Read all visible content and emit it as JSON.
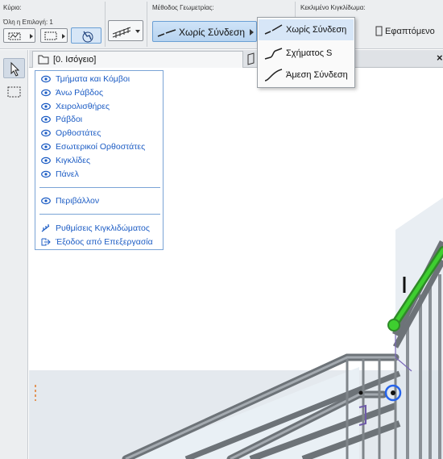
{
  "infobar": {
    "main_section_label": "Κύριο:",
    "selection_label": "Όλη η Επιλογή: 1",
    "geometry_section_label": "Μέθοδος Γεωμετρίας:",
    "geometry_selected": "Χωρίς Σύνδεση",
    "locked_section_label": "Κεκλιμένο Κιγκλίδωμα:",
    "locked_value": "Εφαπτόμενο"
  },
  "dropdown": {
    "items": [
      {
        "label": "Χωρίς Σύνδεση",
        "selected": true
      },
      {
        "label": "Σχήματος S",
        "selected": false
      },
      {
        "label": "Άμεση Σύνδεση",
        "selected": false
      }
    ]
  },
  "tabbar": {
    "tab_label": "[0. Ισόγειο]",
    "close_glyph": "×"
  },
  "context_menu": {
    "group1": [
      {
        "label": "Τμήματα και Κόμβοι",
        "icon": "eye-icon"
      },
      {
        "label": "Άνω Ράβδος",
        "icon": "eye-icon"
      },
      {
        "label": "Χειρολισθήρες",
        "icon": "eye-icon"
      },
      {
        "label": "Ράβδοι",
        "icon": "eye-icon"
      },
      {
        "label": "Ορθοστάτες",
        "icon": "eye-icon"
      },
      {
        "label": "Εσωτερικοί Ορθοστάτες",
        "icon": "eye-icon"
      },
      {
        "label": "Κιγκλίδες",
        "icon": "eye-icon"
      },
      {
        "label": "Πάνελ",
        "icon": "eye-icon"
      }
    ],
    "group2": [
      {
        "label": "Περιβάλλον",
        "icon": "eye-icon"
      }
    ],
    "group3": [
      {
        "label": "Ρυθμίσεις Κιγκλιδώματος",
        "icon": "railing-settings-icon"
      },
      {
        "label": "Έξοδος από Επεξεργασία",
        "icon": "exit-icon"
      }
    ]
  },
  "colors": {
    "accent": "#1c5cc4",
    "highlight_rail": "#3ecf2f",
    "selection_blue": "#2563eb"
  }
}
